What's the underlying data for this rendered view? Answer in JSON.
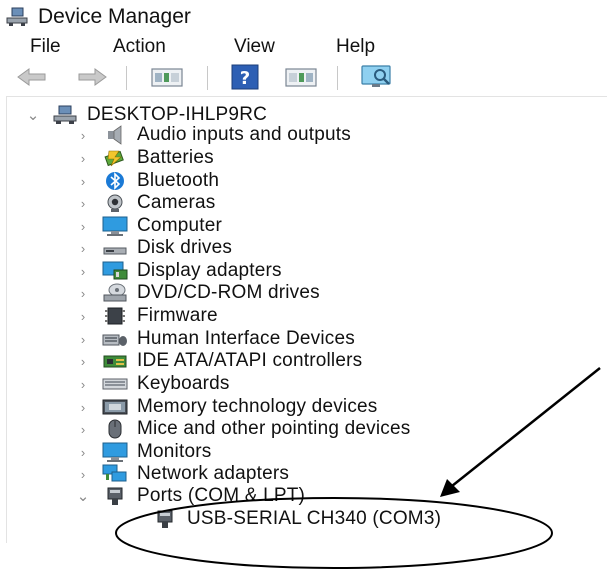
{
  "window": {
    "title": "Device Manager",
    "icon": "computer-icon"
  },
  "menubar": {
    "items": [
      "File",
      "Action",
      "View",
      "Help"
    ]
  },
  "toolbar": {
    "buttons": [
      "back-arrow-icon",
      "forward-arrow-icon",
      "properties-icon",
      "help-icon",
      "update-driver-icon",
      "scan-hardware-icon"
    ]
  },
  "tree": {
    "root": {
      "label": "DESKTOP-IHLP9RC",
      "expanded": true,
      "icon": "computer-icon"
    },
    "categories": [
      {
        "label": "Audio inputs and outputs",
        "icon": "speaker-icon",
        "expanded": false
      },
      {
        "label": "Batteries",
        "icon": "battery-icon",
        "expanded": false
      },
      {
        "label": "Bluetooth",
        "icon": "bluetooth-icon",
        "expanded": false
      },
      {
        "label": "Cameras",
        "icon": "camera-icon",
        "expanded": false
      },
      {
        "label": "Computer",
        "icon": "monitor-icon",
        "expanded": false
      },
      {
        "label": "Disk drives",
        "icon": "disk-drive-icon",
        "expanded": false
      },
      {
        "label": "Display adapters",
        "icon": "display-adapter-icon",
        "expanded": false
      },
      {
        "label": "DVD/CD-ROM drives",
        "icon": "dvd-drive-icon",
        "expanded": false
      },
      {
        "label": "Firmware",
        "icon": "firmware-icon",
        "expanded": false
      },
      {
        "label": "Human Interface Devices",
        "icon": "hid-icon",
        "expanded": false
      },
      {
        "label": "IDE ATA/ATAPI controllers",
        "icon": "ide-controller-icon",
        "expanded": false
      },
      {
        "label": "Keyboards",
        "icon": "keyboard-icon",
        "expanded": false
      },
      {
        "label": "Memory technology devices",
        "icon": "memory-card-icon",
        "expanded": false
      },
      {
        "label": "Mice and other pointing devices",
        "icon": "mouse-icon",
        "expanded": false
      },
      {
        "label": "Monitors",
        "icon": "monitor-icon",
        "expanded": false
      },
      {
        "label": "Network adapters",
        "icon": "network-adapter-icon",
        "expanded": false
      },
      {
        "label": "Ports (COM & LPT)",
        "icon": "port-icon",
        "expanded": true
      }
    ],
    "ports_children": [
      {
        "label": "USB-SERIAL CH340 (COM3)",
        "icon": "port-icon"
      }
    ]
  },
  "annotation": {
    "color": "#000000",
    "shapes": [
      "arrow",
      "ellipse"
    ]
  }
}
